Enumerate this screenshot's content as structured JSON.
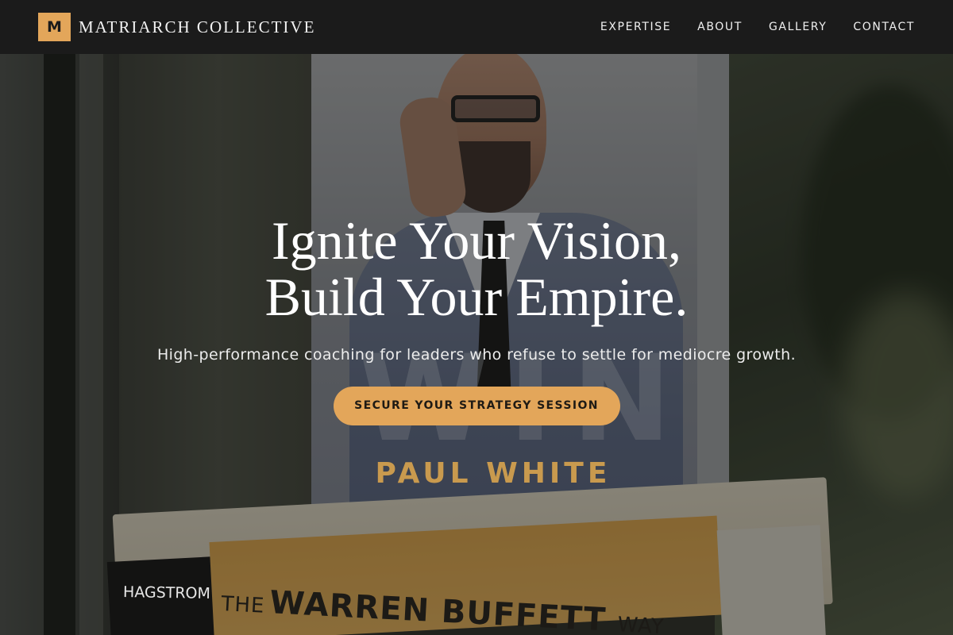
{
  "brand": {
    "mark": "M",
    "name": "MATRIARCH COLLECTIVE"
  },
  "nav": {
    "items": [
      {
        "label": "EXPERTISE"
      },
      {
        "label": "ABOUT"
      },
      {
        "label": "GALLERY"
      },
      {
        "label": "CONTACT"
      }
    ]
  },
  "hero": {
    "headline_line1": "Ignite Your Vision,",
    "headline_line2": "Build Your Empire.",
    "subheadline": "High-performance coaching for leaders who refuse to settle for mediocre growth.",
    "cta_label": "SECURE YOUR STRATEGY SESSION",
    "background_image": {
      "cover_author": "PAUL WHITE",
      "cover_title": "WIN",
      "book_author": "HAGSTROM",
      "book_title_prefix": "THE",
      "book_title_main": "WARREN BUFFETT",
      "book_title_suffix": "WAY"
    }
  },
  "colors": {
    "accent": "#e3a65a",
    "nav_background": "#1b1b1b",
    "text_light": "#ffffff"
  }
}
